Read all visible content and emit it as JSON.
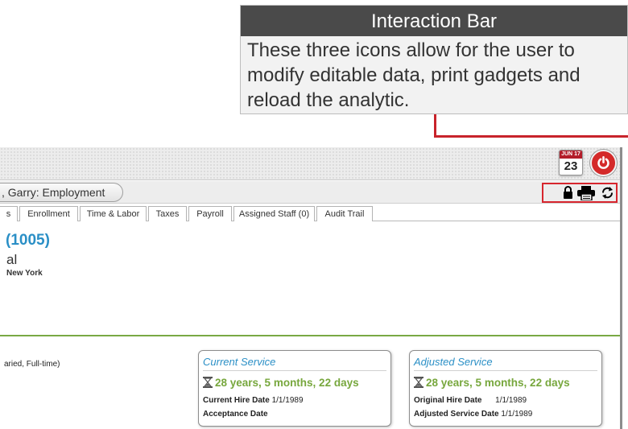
{
  "callout": {
    "title": "Interaction Bar",
    "body": "These three icons allow for the user to modify editable data, print gadgets and reload the analytic."
  },
  "top_bar": {
    "calendar": {
      "month": "JUN",
      "extra": "17",
      "day": "23",
      "icon": "calendar-icon"
    },
    "power_icon": "power-icon"
  },
  "title_bar": {
    "title": ", Garry: Employment",
    "icons": [
      "lock-icon",
      "printer-icon",
      "reload-icon"
    ]
  },
  "tabs": [
    {
      "label": "s"
    },
    {
      "label": "Enrollment"
    },
    {
      "label": "Time & Labor"
    },
    {
      "label": "Taxes"
    },
    {
      "label": "Payroll"
    },
    {
      "label": "Assigned Staff (0)"
    },
    {
      "label": "Audit Trail"
    }
  ],
  "employee": {
    "id": "(1005)",
    "type": "al",
    "location": "New York",
    "classification": "aried, Full-time)"
  },
  "current_service": {
    "title": "Current Service",
    "duration": "28 years, 5 months, 22 days",
    "rows": [
      {
        "label": "Current Hire Date",
        "value": "1/1/1989"
      },
      {
        "label": "Acceptance Date",
        "value": ""
      }
    ]
  },
  "adjusted_service": {
    "title": "Adjusted Service",
    "duration": "28 years, 5 months, 22 days",
    "rows": [
      {
        "label": "Original Hire Date",
        "value": "1/1/1989"
      },
      {
        "label": "Adjusted Service Date",
        "value": "1/1/1989"
      }
    ]
  },
  "colors": {
    "accent_blue": "#2a8fc6",
    "accent_green": "#77a73d",
    "callout_red": "#c8232b"
  }
}
